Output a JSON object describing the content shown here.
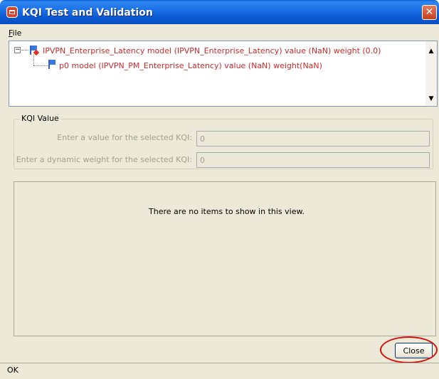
{
  "window": {
    "title": "KQI Test and Validation",
    "close_glyph": "✕"
  },
  "menu": {
    "file_mnemonic": "F",
    "file_rest": "ile"
  },
  "tree": {
    "root": {
      "label": "IPVPN_Enterprise_Latency model (IPVPN_Enterprise_Latency)   value (NaN)   weight (0.0)",
      "icon": "kqi-flag-icon",
      "expanded": true,
      "expander_glyph": "−"
    },
    "children": [
      {
        "label": "p0 model (IPVPN_PM_Enterprise_Latency)   value (NaN)   weight(NaN)",
        "icon": "flag-icon"
      }
    ],
    "scroll_up_glyph": "▲",
    "scroll_down_glyph": "▼"
  },
  "kqi_value": {
    "legend": "KQI Value",
    "value_label": "Enter a value for the selected KQI:",
    "value_field": "0",
    "weight_label": "Enter a dynamic weight for the selected KQI:",
    "weight_field": "0"
  },
  "results": {
    "empty_message": "There are no items to show in this view."
  },
  "buttons": {
    "close_label": "Close"
  },
  "status": {
    "text": "OK"
  },
  "colors": {
    "title_bar": "#0a58d0",
    "window_bg": "#ece9d8",
    "tree_text": "#cc2a2a",
    "highlight": "#d80e0e"
  }
}
